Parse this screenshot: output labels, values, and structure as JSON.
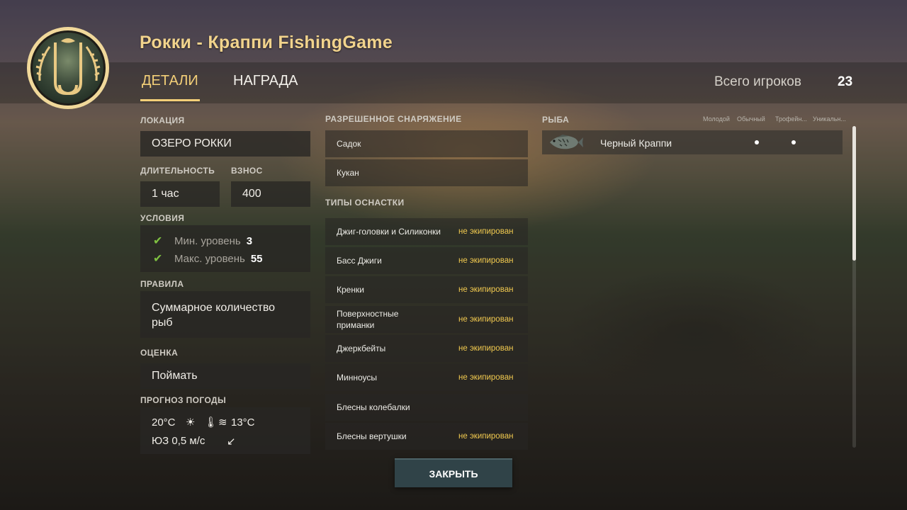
{
  "header": {
    "title": "Рокки - Краппи FishingGame",
    "tabs": [
      {
        "label": "ДЕТАЛИ",
        "active": true
      },
      {
        "label": "НАГРАДА",
        "active": false
      }
    ],
    "players_label": "Всего игроков",
    "players_count": "23",
    "logo_icon": "crossed-hooks-emblem-icon"
  },
  "details": {
    "location_label": "ЛОКАЦИЯ",
    "location_value": "ОЗЕРО РОККИ",
    "duration_label": "ДЛИТЕЛЬНОСТЬ",
    "duration_value": "1 час",
    "fee_label": "ВЗНОС",
    "fee_value": "400",
    "conditions_label": "УСЛОВИЯ",
    "conditions": [
      {
        "label": "Мин. уровень",
        "value": "3"
      },
      {
        "label": "Макс. уровень",
        "value": "55"
      }
    ],
    "rules_label": "ПРАВИЛА",
    "rules_value_1": "Суммарное количество",
    "rules_value_2": "рыб",
    "scoring_label": "ОЦЕНКА",
    "scoring_value": "Поймать",
    "weather_label": "ПРОГНОЗ ПОГОДЫ",
    "weather": {
      "air_temp": "20°C",
      "water_temp": "13°C",
      "wind": "ЮЗ 0,5 м/с"
    }
  },
  "equipment": {
    "allowed_label": "РАЗРЕШЕННОЕ СНАРЯЖЕНИЕ",
    "allowed": [
      {
        "name": "Садок"
      },
      {
        "name": "Кукан"
      }
    ],
    "rig_label": "ТИПЫ ОСНАСТКИ",
    "rigs": [
      {
        "name": "Джиг-головки и Силиконки",
        "status": "не экипирован"
      },
      {
        "name": "Басс Джиги",
        "status": "не экипирован"
      },
      {
        "name": "Кренки",
        "status": "не экипирован"
      },
      {
        "name": "Поверхностные приманки",
        "status": "не экипирован"
      },
      {
        "name": "Джеркбейты",
        "status": "не экипирован"
      },
      {
        "name": "Минноусы",
        "status": "не экипирован"
      },
      {
        "name": "Блесны колебалки",
        "status": ""
      },
      {
        "name": "Блесны вертушки",
        "status": "не экипирован"
      }
    ]
  },
  "fish": {
    "label": "РЫБА",
    "columns": [
      "Молодой",
      "Обычный",
      "Трофейн...",
      "Уникальн..."
    ],
    "rows": [
      {
        "name": "Черный Краппи",
        "columns_marked": [
          "Обычный",
          "Трофейн..."
        ]
      }
    ]
  },
  "footer": {
    "close_label": "ЗАКРЫТЬ"
  },
  "colors": {
    "accent_gold": "#f3cf78",
    "status_yellow": "#f1c94f",
    "check_green": "#7fc141",
    "button_teal": "#304348"
  }
}
